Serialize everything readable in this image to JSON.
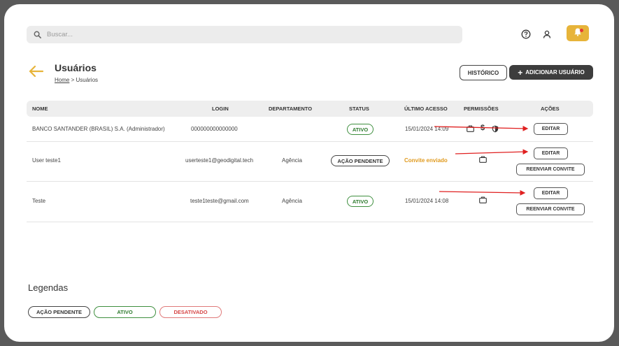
{
  "search": {
    "placeholder": "Buscar..."
  },
  "header": {
    "title": "Usuários",
    "breadcrumb_home": "Home",
    "breadcrumb_sep": " > ",
    "breadcrumb_current": "Usuários",
    "history_button": "HISTÓRICO",
    "add_button": "ADICIONAR USUÁRIO"
  },
  "table": {
    "columns": [
      "NOME",
      "LOGIN",
      "DEPARTAMENTO",
      "STATUS",
      "ÚLTIMO ACESSO",
      "PERMISSÕES",
      "AÇÕES"
    ],
    "rows": [
      {
        "name": "BANCO SANTANDER (BRASIL) S.A. (Administrador)",
        "login": "000000000000000",
        "department": "",
        "status": "ATIVO",
        "last_access": "15/01/2024 14:09",
        "permissions": [
          "briefcase-icon",
          "dollar-icon",
          "shield-icon"
        ],
        "actions": [
          "EDITAR"
        ]
      },
      {
        "name": "User teste1",
        "login": "userteste1@geodigital.tech",
        "department": "Agência",
        "status": "AÇÃO PENDENTE",
        "last_access": "Convite enviado",
        "permissions": [
          "briefcase-icon"
        ],
        "actions": [
          "EDITAR",
          "REENVIAR CONVITE"
        ]
      },
      {
        "name": "Teste",
        "login": "teste1teste@gmail.com",
        "department": "Agência",
        "status": "ATIVO",
        "last_access": "15/01/2024 14:08",
        "permissions": [
          "briefcase-icon"
        ],
        "actions": [
          "EDITAR",
          "REENVIAR CONVITE"
        ]
      }
    ]
  },
  "legend": {
    "title": "Legendas",
    "items": [
      "AÇÃO PENDENTE",
      "ATIVO",
      "DESATIVADO"
    ]
  },
  "colors": {
    "accent_yellow": "#e7b43a",
    "active_green": "#2d7a2d",
    "inactive_red": "#d64545",
    "pending_orange": "#e09a1e",
    "annotation_red": "#e02020"
  }
}
